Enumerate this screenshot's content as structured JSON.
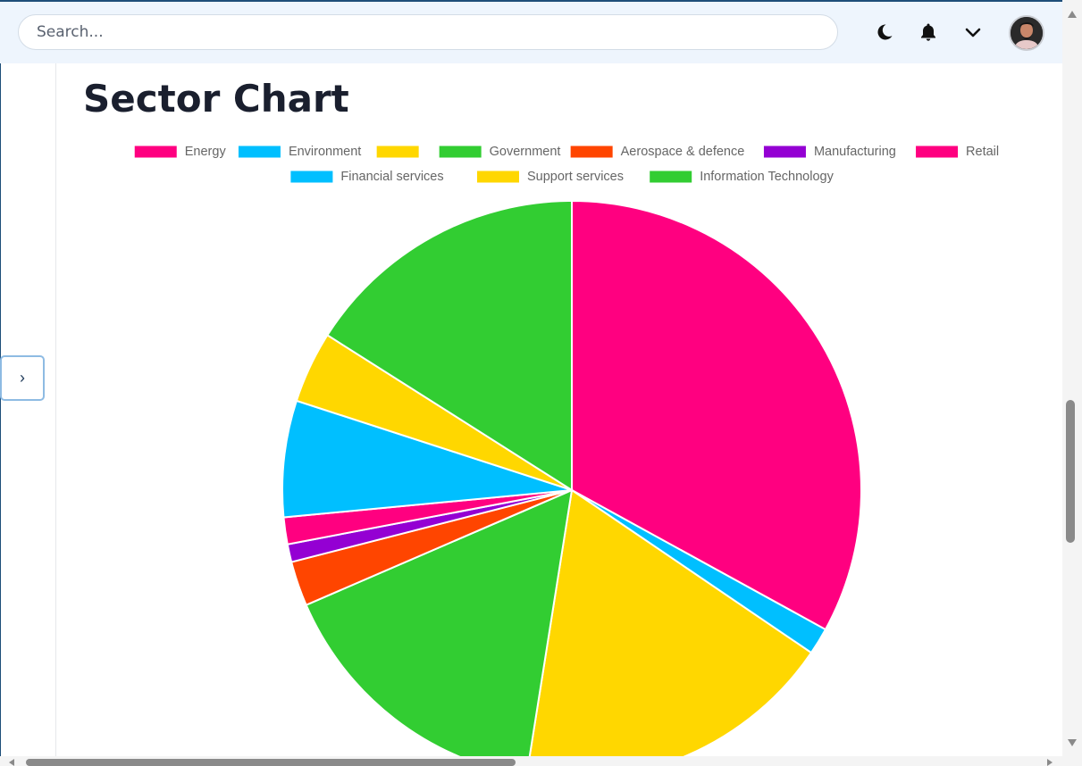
{
  "search": {
    "placeholder": "Search..."
  },
  "header": {
    "icons": [
      "moon-icon",
      "bell-icon",
      "chevron-down-icon",
      "avatar"
    ]
  },
  "sidebar": {
    "toggle_icon": "chevron-right-icon",
    "toggle_label": "›"
  },
  "page": {
    "title": "Sector Chart"
  },
  "chart_data": {
    "type": "pie",
    "title": "",
    "legend_position": "top",
    "slice_border_color": "#ffffff",
    "categories": [
      "Energy",
      "Environment",
      "",
      "Government",
      "Aerospace & defence",
      "Manufacturing",
      "Retail",
      "Financial services",
      "Support services",
      "Information Technology"
    ],
    "colors": [
      "#ff0080",
      "#00bfff",
      "#ffd700",
      "#32cd32",
      "#ff4500",
      "#9400d3",
      "#ff0080",
      "#00bfff",
      "#ffd700",
      "#32cd32"
    ],
    "values": [
      33.0,
      1.5,
      18.0,
      16.0,
      2.5,
      1.0,
      1.5,
      6.5,
      4.0,
      16.0
    ]
  }
}
